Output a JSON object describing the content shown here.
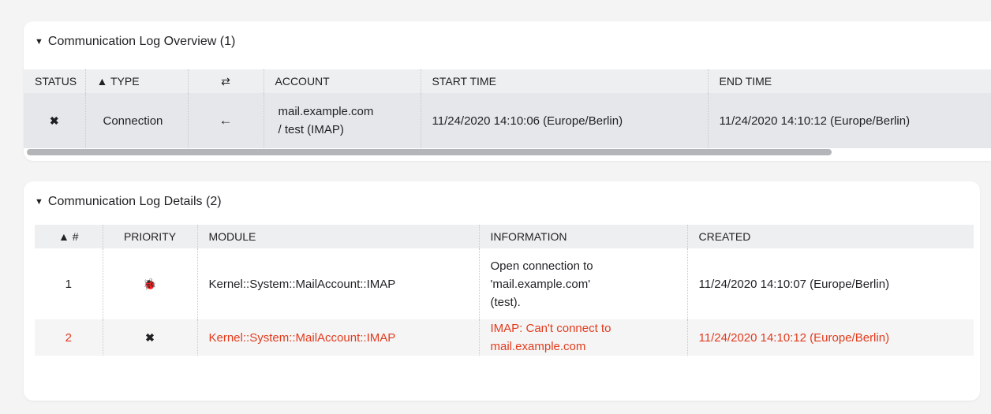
{
  "overview": {
    "title": "Communication Log Overview (1)",
    "columns": {
      "status": "STATUS",
      "type": "▲ TYPE",
      "direction": "⇄",
      "account": "ACCOUNT",
      "start_time": "START TIME",
      "end_time": "END TIME"
    },
    "rows": [
      {
        "status_icon": "✖",
        "type": "Connection",
        "direction_icon": "←",
        "account_line1": "mail.example.com",
        "account_line2": "/ test (IMAP)",
        "start_time": "11/24/2020 14:10:06 (Europe/Berlin)",
        "end_time": "11/24/2020 14:10:12 (Europe/Berlin)"
      }
    ]
  },
  "details": {
    "title": "Communication Log Details (2)",
    "columns": {
      "num": "▲ #",
      "priority": "PRIORITY",
      "module": "MODULE",
      "information": "INFORMATION",
      "created": "CREATED"
    },
    "rows": [
      {
        "num": "1",
        "priority_icon": "🐞",
        "module": "Kernel::System::MailAccount::IMAP",
        "info_line1": "Open connection to",
        "info_line2": "'mail.example.com'",
        "info_line3": "(test).",
        "created": "11/24/2020 14:10:07 (Europe/Berlin)"
      },
      {
        "num": "2",
        "priority_icon": "✖",
        "module": "Kernel::System::MailAccount::IMAP",
        "info_line1": "IMAP: Can't connect to",
        "info_line2": "mail.example.com",
        "created": "11/24/2020 14:10:12 (Europe/Berlin)"
      }
    ]
  },
  "colors": {
    "error_text": "#e23b1c",
    "header_bg": "#eeeff1",
    "selected_row_bg": "#e6e7ea"
  }
}
